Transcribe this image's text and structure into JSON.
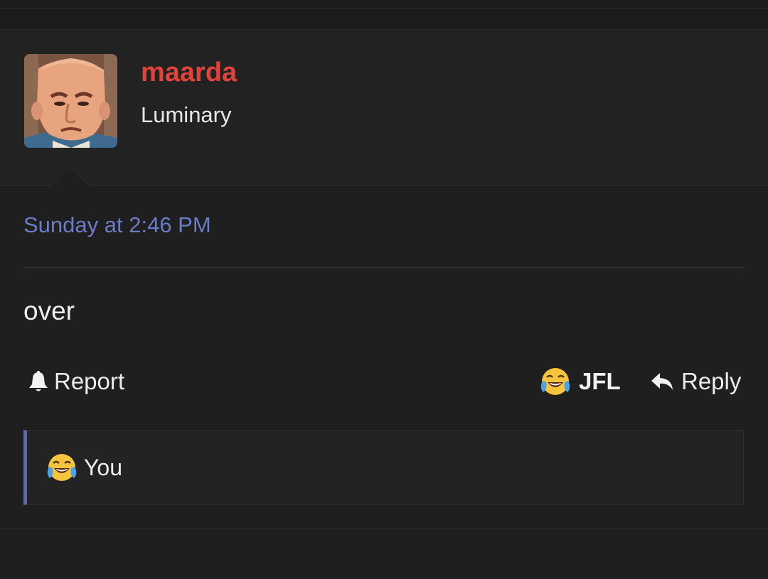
{
  "post": {
    "author": {
      "username": "maarda",
      "username_color": "#e0433a",
      "title": "Luminary",
      "avatar_icon": "cartoon-face-avatar"
    },
    "date": "Sunday at 2:46 PM",
    "message": "over",
    "actions": {
      "report_label": "Report",
      "report_icon": "bell-icon",
      "reaction_label": "JFL",
      "reaction_icon": "tears-of-joy-icon",
      "reply_label": "Reply",
      "reply_icon": "reply-arrow-icon"
    },
    "reactions_summary": {
      "icon": "tears-of-joy-icon",
      "text": "You"
    }
  },
  "colors": {
    "background": "#1e1e1e",
    "accent_link": "#6b7bc8",
    "reactions_border": "#5b67b8"
  }
}
